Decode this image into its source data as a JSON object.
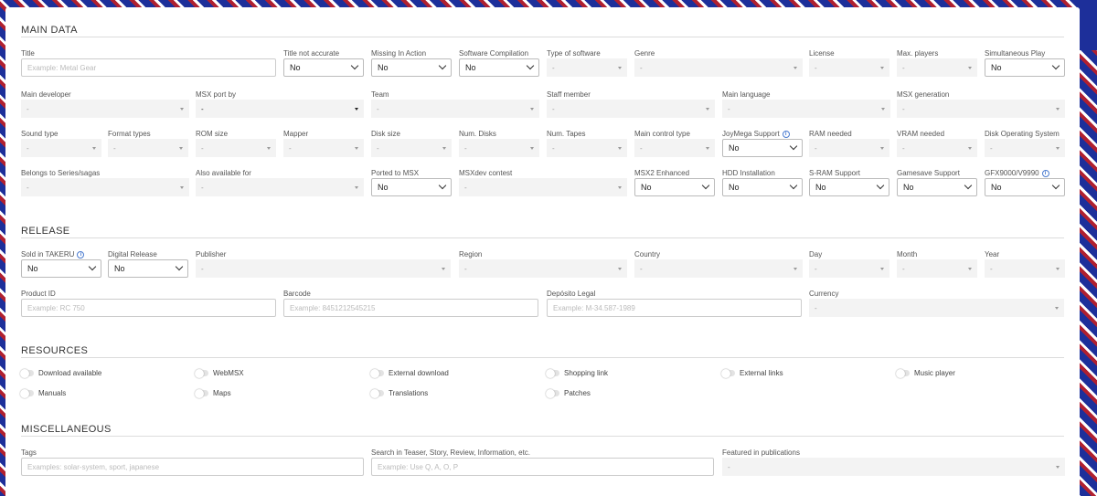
{
  "sections": {
    "main": "MAIN DATA",
    "release": "RELEASE",
    "resources": "RESOURCES",
    "misc": "MISCELLANEOUS"
  },
  "main": {
    "row1": [
      {
        "label": "Title",
        "kind": "input",
        "value": "",
        "placeholder": "Example: Metal Gear"
      },
      {
        "label": "Title not accurate",
        "kind": "select",
        "value": "No"
      },
      {
        "label": "Missing In Action",
        "kind": "select",
        "value": "No"
      },
      {
        "label": "Software Compilation",
        "kind": "select",
        "value": "No"
      },
      {
        "label": "Type of software",
        "kind": "grey",
        "value": "-"
      },
      {
        "label": "Genre",
        "kind": "grey",
        "value": "-"
      },
      {
        "label": "License",
        "kind": "grey",
        "value": "-"
      },
      {
        "label": "Max. players",
        "kind": "grey",
        "value": "-"
      },
      {
        "label": "Simultaneous Play",
        "kind": "select",
        "value": "No"
      }
    ],
    "row2": [
      {
        "label": "Main developer",
        "kind": "grey",
        "value": "-"
      },
      {
        "label": "MSX port by",
        "kind": "greydark",
        "value": "-"
      },
      {
        "label": "Team",
        "kind": "grey",
        "value": "-"
      },
      {
        "label": "Staff member",
        "kind": "grey",
        "value": "-"
      },
      {
        "label": "Main language",
        "kind": "grey",
        "value": "-"
      },
      {
        "label": "MSX generation",
        "kind": "grey",
        "value": "-"
      }
    ],
    "row3": [
      {
        "label": "Sound type",
        "kind": "grey",
        "value": "-"
      },
      {
        "label": "Format types",
        "kind": "grey",
        "value": "-"
      },
      {
        "label": "ROM size",
        "kind": "grey",
        "value": "-"
      },
      {
        "label": "Mapper",
        "kind": "grey",
        "value": "-"
      },
      {
        "label": "Disk size",
        "kind": "grey",
        "value": "-"
      },
      {
        "label": "Num. Disks",
        "kind": "grey",
        "value": "-"
      },
      {
        "label": "Num. Tapes",
        "kind": "grey",
        "value": "-"
      },
      {
        "label": "Main control type",
        "kind": "grey",
        "value": "-"
      },
      {
        "label": "JoyMega Support",
        "kind": "select",
        "value": "No",
        "info": true
      },
      {
        "label": "RAM needed",
        "kind": "grey",
        "value": "-"
      },
      {
        "label": "VRAM needed",
        "kind": "grey",
        "value": "-"
      },
      {
        "label": "Disk Operating System",
        "kind": "grey",
        "value": "-"
      }
    ],
    "row4": [
      {
        "label": "Belongs to Series/sagas",
        "kind": "grey",
        "value": "-"
      },
      {
        "label": "Also available for",
        "kind": "grey",
        "value": "-"
      },
      {
        "label": "Ported to MSX",
        "kind": "select",
        "value": "No"
      },
      {
        "label": "MSXdev contest",
        "kind": "grey",
        "value": "-"
      },
      {
        "label": "MSX2 Enhanced",
        "kind": "select",
        "value": "No"
      },
      {
        "label": "HDD Installation",
        "kind": "select",
        "value": "No"
      },
      {
        "label": "S-RAM Support",
        "kind": "select",
        "value": "No"
      },
      {
        "label": "Gamesave Support",
        "kind": "select",
        "value": "No"
      },
      {
        "label": "GFX9000/V9990",
        "kind": "select",
        "value": "No",
        "info": true
      }
    ]
  },
  "release": {
    "row1": [
      {
        "label": "Sold in TAKERU",
        "kind": "select",
        "value": "No",
        "info": true
      },
      {
        "label": "Digital Release",
        "kind": "select",
        "value": "No"
      },
      {
        "label": "Publisher",
        "kind": "grey",
        "value": "-"
      },
      {
        "label": "Region",
        "kind": "grey",
        "value": "-"
      },
      {
        "label": "Country",
        "kind": "grey",
        "value": "-"
      },
      {
        "label": "Day",
        "kind": "grey",
        "value": "-"
      },
      {
        "label": "Month",
        "kind": "grey",
        "value": "-"
      },
      {
        "label": "Year",
        "kind": "grey",
        "value": "-"
      }
    ],
    "row2": [
      {
        "label": "Product ID",
        "kind": "input",
        "value": "",
        "placeholder": "Example: RC 750"
      },
      {
        "label": "Barcode",
        "kind": "input",
        "value": "",
        "placeholder": "Example: 8451212545215"
      },
      {
        "label": "Depósito Legal",
        "kind": "input",
        "value": "",
        "placeholder": "Example: M-34.587-1989"
      },
      {
        "label": "Currency",
        "kind": "grey",
        "value": "-"
      }
    ]
  },
  "resources": [
    "Download available",
    "WebMSX",
    "External download",
    "Shopping link",
    "External links",
    "Music player",
    "Manuals",
    "Maps",
    "Translations",
    "Patches"
  ],
  "misc": [
    {
      "label": "Tags",
      "kind": "input",
      "value": "",
      "placeholder": "Examples: solar-system, sport, japanese"
    },
    {
      "label": "Search in Teaser, Story, Review, Information, etc.",
      "kind": "input",
      "value": "",
      "placeholder": "Example: Use Q, A, O, P"
    },
    {
      "label": "Featured in publications",
      "kind": "grey",
      "value": "-"
    }
  ]
}
